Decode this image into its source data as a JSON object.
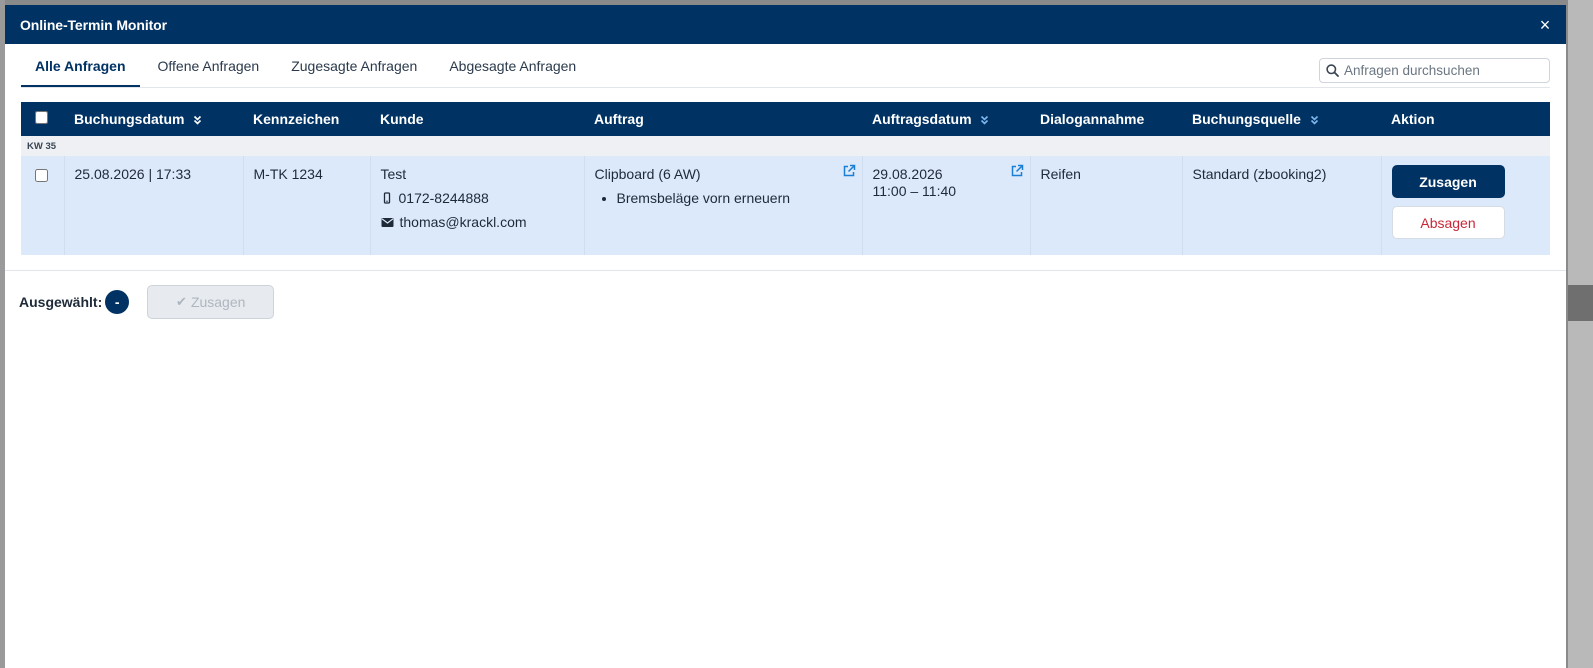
{
  "modal": {
    "title": "Online-Termin Monitor",
    "close_symbol": "×"
  },
  "tabs": [
    {
      "label": "Alle Anfragen",
      "active": true
    },
    {
      "label": "Offene Anfragen",
      "active": false
    },
    {
      "label": "Zugesagte Anfragen",
      "active": false
    },
    {
      "label": "Abgesagte Anfragen",
      "active": false
    }
  ],
  "search": {
    "placeholder": "Anfragen durchsuchen",
    "icon": "search-icon"
  },
  "table": {
    "columns": [
      {
        "label": "",
        "type": "checkbox"
      },
      {
        "label": "Buchungsdatum",
        "sortable": true
      },
      {
        "label": "Kennzeichen",
        "sortable": false
      },
      {
        "label": "Kunde",
        "sortable": false
      },
      {
        "label": "Auftrag",
        "sortable": false
      },
      {
        "label": "Auftragsdatum",
        "sortable": true
      },
      {
        "label": "Dialogannahme",
        "sortable": false
      },
      {
        "label": "Buchungsquelle",
        "sortable": true
      },
      {
        "label": "Aktion",
        "sortable": false
      }
    ],
    "groups": [
      {
        "label": "KW 35",
        "rows": [
          {
            "buchungsdatum": "25.08.2026 | 17:33",
            "kennzeichen": "M-TK 1234",
            "kunde_name": "Test",
            "kunde_phone": "0172-8244888",
            "kunde_email": "thomas@krackl.com",
            "auftrag_title": "Clipboard (6 AW)",
            "auftrag_items": [
              "Bremsbeläge vorn erneuern"
            ],
            "auftragsdatum_date": "29.08.2026",
            "auftragsdatum_time": "11:00 – 11:40",
            "dialogannahme": "Reifen",
            "buchungsquelle": "Standard (zbooking2)",
            "accept_label": "Zusagen",
            "reject_label": "Absagen"
          }
        ]
      }
    ]
  },
  "footer": {
    "selected_label": "Ausgewählt:",
    "selected_count": "-",
    "bulk_accept_label": "Zusagen"
  },
  "colors": {
    "primary": "#003263",
    "row_highlight": "#dce9fb",
    "danger": "#c8283a",
    "link": "#1a7fd4"
  }
}
